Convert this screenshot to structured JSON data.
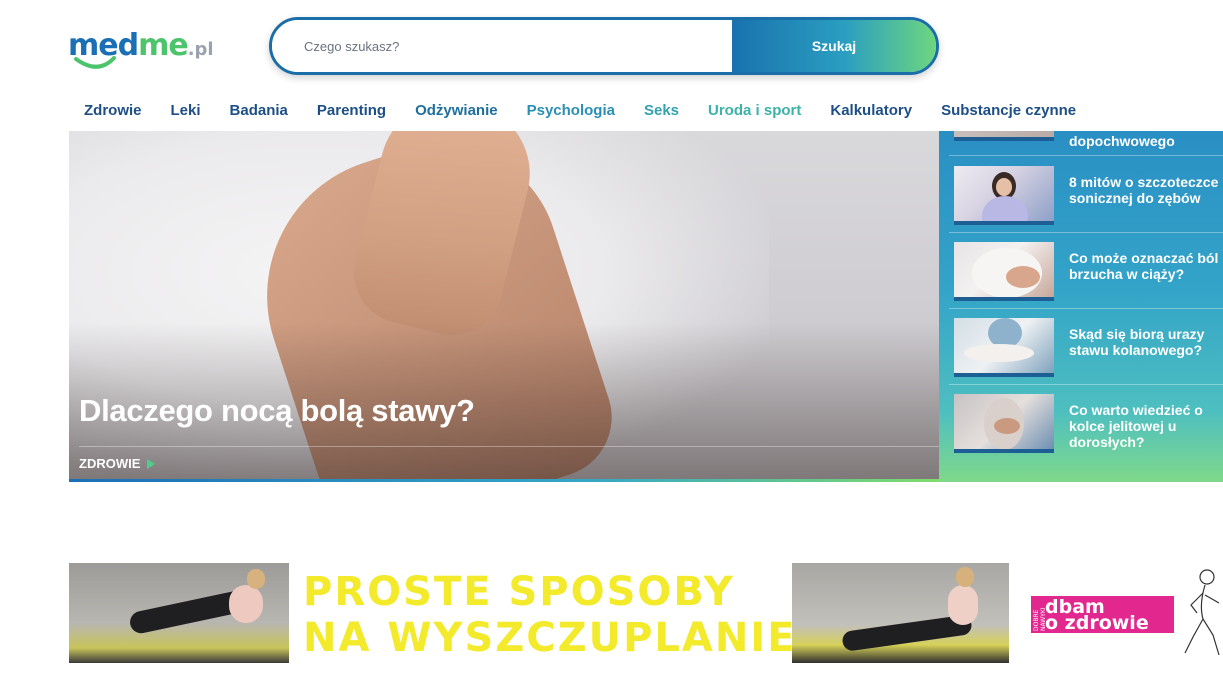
{
  "header": {
    "logo": {
      "part1": "med",
      "part2": "me",
      "part3": ".pl"
    },
    "search": {
      "placeholder": "Czego szukasz?",
      "button_label": "Szukaj"
    }
  },
  "nav": {
    "items": [
      {
        "label": "Zdrowie",
        "color": "#1d4f86"
      },
      {
        "label": "Leki",
        "color": "#1d4f86"
      },
      {
        "label": "Badania",
        "color": "#1d4f86"
      },
      {
        "label": "Parenting",
        "color": "#1d4f86"
      },
      {
        "label": "Odżywianie",
        "color": "#1d6f9e"
      },
      {
        "label": "Psychologia",
        "color": "#2a8fb5"
      },
      {
        "label": "Seks",
        "color": "#34a3b0"
      },
      {
        "label": "Uroda i sport",
        "color": "#3bb3a8"
      },
      {
        "label": "Kalkulatory",
        "color": "#1d4f86"
      },
      {
        "label": "Substancje czynne",
        "color": "#1d4f86"
      }
    ]
  },
  "hero": {
    "title": "Dlaczego nocą bolą stawy?",
    "category": "ZDROWIE"
  },
  "sidebar": {
    "items": [
      {
        "title": "dopochwowego"
      },
      {
        "title": "8 mitów o szczoteczce sonicznej do zębów"
      },
      {
        "title": "Co może oznaczać ból brzucha w ciąży?"
      },
      {
        "title": "Skąd się biorą urazy stawu kolanowego?"
      },
      {
        "title": "Co warto wiedzieć o kolce jelitowej u dorosłych?"
      }
    ]
  },
  "ad": {
    "headline_line1": "PROSTE SPOSOBY",
    "headline_line2": "NA WYSZCZUPLANIE",
    "brand_small": "DOBRE NAWYKI",
    "brand_line1": "dbam",
    "brand_line2": "o zdrowie"
  },
  "colors": {
    "brand_blue": "#1a6fb5",
    "brand_green": "#4cc46b",
    "ad_yellow": "#f2ea2a",
    "ad_pink": "#e2278f"
  }
}
